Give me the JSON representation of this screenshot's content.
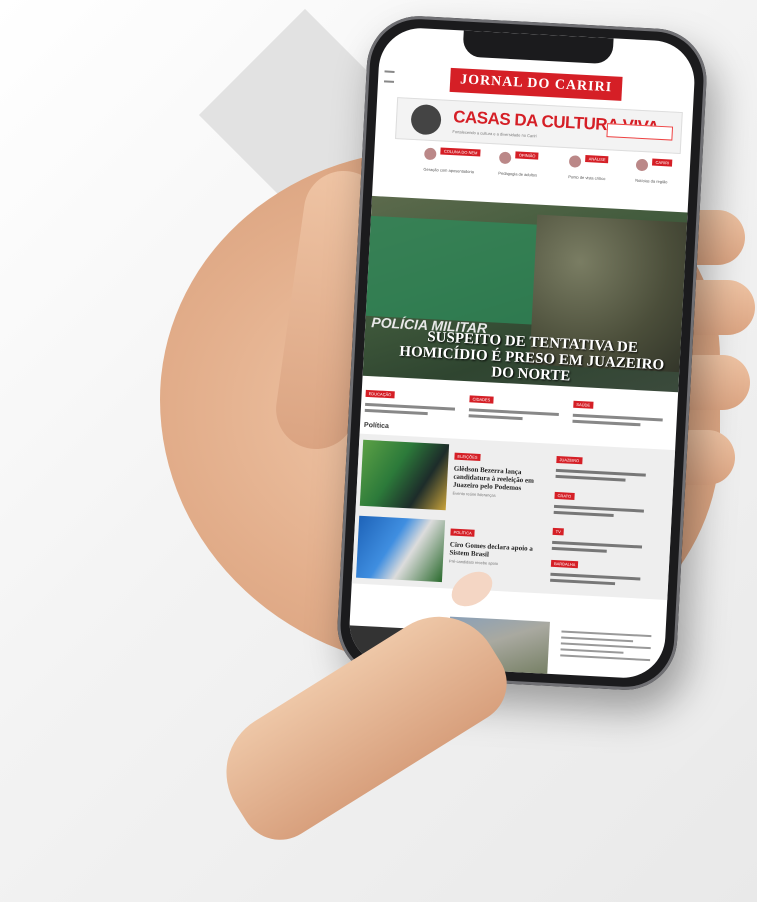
{
  "site": {
    "logo_text": "JORNAL DO CARIRI",
    "banner_title": "CASAS DA CULTURA VIVA",
    "banner_subtitle": "Fortalecendo a cultura e a diversidade no Cariri"
  },
  "columnists": [
    {
      "tag": "COLUNA DO NEM",
      "text": "Geração com aposentadoria"
    },
    {
      "tag": "OPINIÃO",
      "text": "Pedagogia de adultos"
    },
    {
      "tag": "ANÁLISE",
      "text": "Ponto de vista crítico"
    },
    {
      "tag": "CARIRI",
      "text": "Notícias da região"
    }
  ],
  "hero": {
    "badge": "POLÍCIA MILITAR",
    "headline": "SUSPEITO DE TENTATIVA DE HOMICÍDIO É PRESO EM JUAZEIRO DO NORTE"
  },
  "news_strip": [
    {
      "tag": "EDUCAÇÃO"
    },
    {
      "tag": "CIDADES"
    },
    {
      "tag": "SAÚDE"
    }
  ],
  "section": {
    "title": "Política"
  },
  "articles": [
    {
      "tag": "ELEIÇÕES",
      "headline": "Glêdson Bezerra lança candidatura à reeleição em Juazeiro pelo Podemos",
      "sub": "Evento reúne lideranças"
    },
    {
      "tag": "POLÍTICA",
      "headline": "Ciro Gomes declara apoio a Sistem Brasil",
      "sub": "Pré-candidato recebe apoio"
    }
  ],
  "sidebar": [
    {
      "tag": "JUAZEIRO"
    },
    {
      "tag": "CRATO"
    },
    {
      "tag": "TV"
    },
    {
      "tag": "BARBALHA"
    }
  ],
  "colors": {
    "brand_red": "#d51f26"
  }
}
